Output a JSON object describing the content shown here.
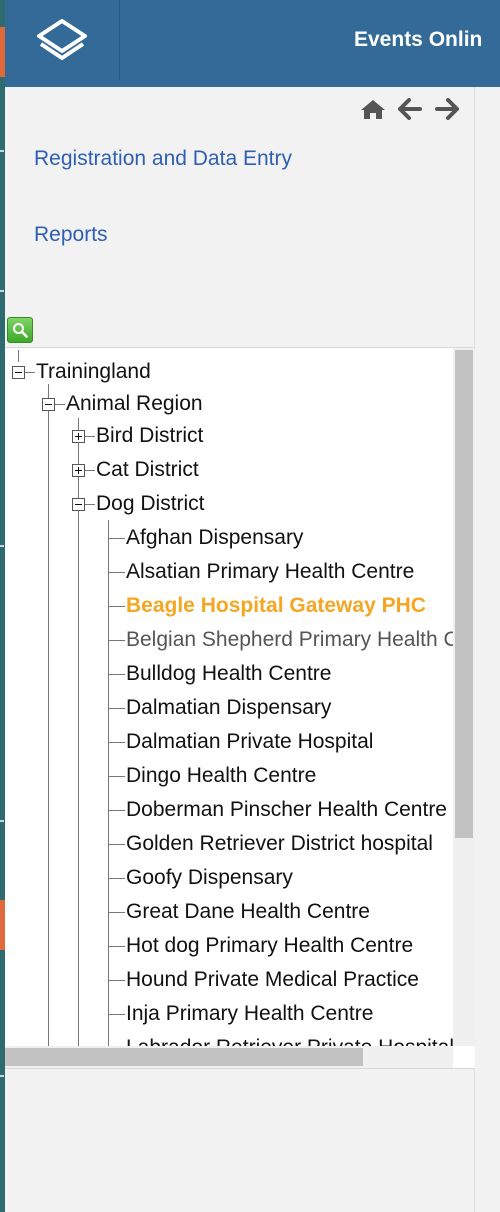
{
  "header": {
    "app_title": "Events Onlin",
    "logo_icon": "dhis2-logo-icon",
    "background": "#336a97"
  },
  "nav_icons": [
    "home-icon",
    "arrow-left-icon",
    "arrow-right-icon"
  ],
  "menu": {
    "registration": "Registration and Data Entry",
    "reports": "Reports"
  },
  "search_icon": "search-icon",
  "tree": {
    "root": "Trainingland",
    "region": "Animal Region",
    "districts": [
      {
        "label": "Bird District",
        "state": "collapsed"
      },
      {
        "label": "Cat District",
        "state": "collapsed"
      },
      {
        "label": "Dog District",
        "state": "expanded"
      }
    ],
    "facilities": [
      {
        "label": "Afghan Dispensary",
        "status": "normal"
      },
      {
        "label": "Alsatian Primary Health Centre",
        "status": "normal"
      },
      {
        "label": "Beagle Hospital Gateway PHC",
        "status": "selected"
      },
      {
        "label": "Belgian Shepherd Primary Health Centre",
        "status": "muted"
      },
      {
        "label": "Bulldog Health Centre",
        "status": "normal"
      },
      {
        "label": "Dalmatian Dispensary",
        "status": "normal"
      },
      {
        "label": "Dalmatian Private Hospital",
        "status": "normal"
      },
      {
        "label": "Dingo Health Centre",
        "status": "normal"
      },
      {
        "label": "Doberman Pinscher Health Centre",
        "status": "normal"
      },
      {
        "label": "Golden Retriever District hospital",
        "status": "normal"
      },
      {
        "label": "Goofy Dispensary",
        "status": "normal"
      },
      {
        "label": "Great Dane Health Centre",
        "status": "normal"
      },
      {
        "label": "Hot dog Primary Health Centre",
        "status": "normal"
      },
      {
        "label": "Hound Private Medical Practice",
        "status": "normal"
      },
      {
        "label": "Inja Primary Health Centre",
        "status": "normal"
      },
      {
        "label": "Labrador Retriever Private Hospital",
        "status": "normal"
      }
    ]
  },
  "colors": {
    "link": "#2f5fb3",
    "selected": "#f5a623"
  }
}
